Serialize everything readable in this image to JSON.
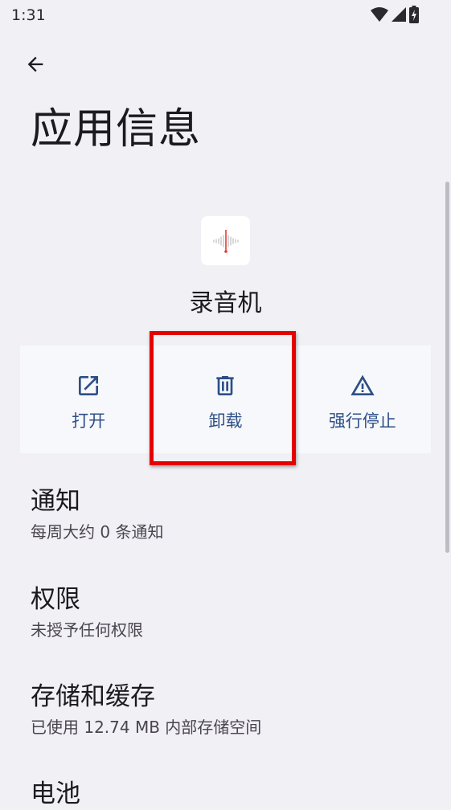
{
  "status_bar": {
    "time": "1:31"
  },
  "header": {
    "title": "应用信息"
  },
  "app": {
    "name": "录音机"
  },
  "actions": [
    {
      "label": "打开"
    },
    {
      "label": "卸载"
    },
    {
      "label": "强行停止"
    }
  ],
  "settings": [
    {
      "title": "通知",
      "subtitle": "每周大约 0 条通知"
    },
    {
      "title": "权限",
      "subtitle": "未授予任何权限"
    },
    {
      "title": "存储和缓存",
      "subtitle": "已使用 12.74 MB 内部存储空间"
    },
    {
      "title": "电池"
    }
  ],
  "colors": {
    "accent": "#2d4f86",
    "highlight": "#e60000",
    "background": "#f1f0f5"
  }
}
